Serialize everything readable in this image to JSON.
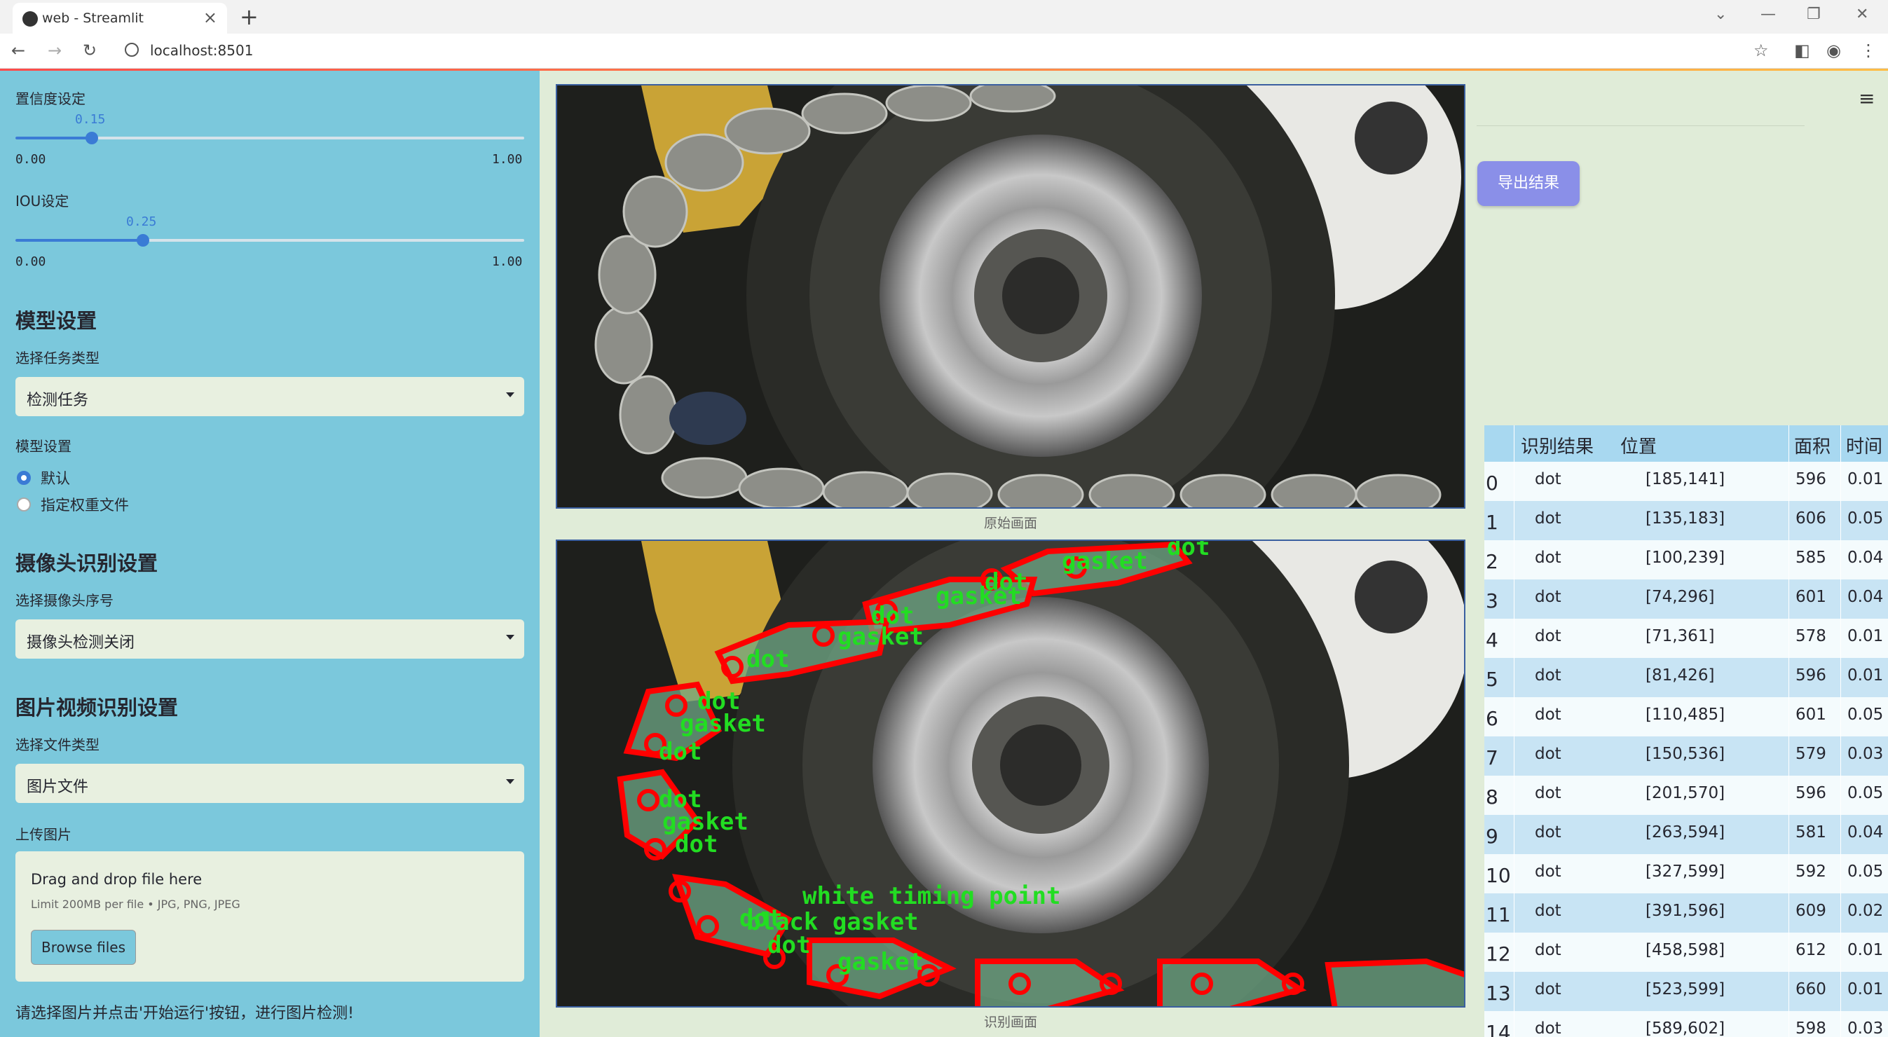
{
  "browser": {
    "tab_title": "web - Streamlit",
    "url": "localhost:8501"
  },
  "sidebar": {
    "confidence": {
      "label": "置信度设定",
      "value": "0.15",
      "min": "0.00",
      "max": "1.00",
      "fraction": 0.15
    },
    "iou": {
      "label": "IOU设定",
      "value": "0.25",
      "min": "0.00",
      "max": "1.00",
      "fraction": 0.25
    },
    "model_section": {
      "title": "模型设置",
      "task_label": "选择任务类型",
      "task_value": "检测任务",
      "model_label": "模型设置",
      "options": [
        "默认",
        "指定权重文件"
      ],
      "selected": "默认"
    },
    "camera_section": {
      "title": "摄像头识别设置",
      "camera_label": "选择摄像头序号",
      "camera_value": "摄像头检测关闭"
    },
    "file_section": {
      "title": "图片视频识别设置",
      "file_type_label": "选择文件类型",
      "file_type_value": "图片文件",
      "upload_label": "上传图片",
      "drop_text": "Drag and drop file here",
      "limit_text": "Limit 200MB per file • JPG, PNG, JPEG",
      "browse_label": "Browse files"
    },
    "note": "请选择图片并点击'开始运行'按钮，进行图片检测!"
  },
  "main": {
    "original_caption": "原始画面",
    "result_caption": "识别画面",
    "overlay_labels": [
      "dot",
      "gasket",
      "dot",
      "gasket",
      "dot",
      "gasket",
      "dot",
      "gasket",
      "dot",
      "dot",
      "gasket",
      "dot",
      "dot",
      "white timing point",
      "black gasket",
      "dot",
      "gasket"
    ]
  },
  "right": {
    "export_label": "导出结果",
    "table": {
      "headers": [
        "识别结果",
        "位置",
        "面积",
        "时间"
      ],
      "rows": [
        [
          "0",
          "dot",
          "[185,141]",
          "596",
          "0.01"
        ],
        [
          "1",
          "dot",
          "[135,183]",
          "606",
          "0.05"
        ],
        [
          "2",
          "dot",
          "[100,239]",
          "585",
          "0.04"
        ],
        [
          "3",
          "dot",
          "[74,296]",
          "601",
          "0.04"
        ],
        [
          "4",
          "dot",
          "[71,361]",
          "578",
          "0.01"
        ],
        [
          "5",
          "dot",
          "[81,426]",
          "596",
          "0.01"
        ],
        [
          "6",
          "dot",
          "[110,485]",
          "601",
          "0.05"
        ],
        [
          "7",
          "dot",
          "[150,536]",
          "579",
          "0.03"
        ],
        [
          "8",
          "dot",
          "[201,570]",
          "596",
          "0.05"
        ],
        [
          "9",
          "dot",
          "[263,594]",
          "581",
          "0.04"
        ],
        [
          "10",
          "dot",
          "[327,599]",
          "592",
          "0.05"
        ],
        [
          "11",
          "dot",
          "[391,596]",
          "609",
          "0.02"
        ],
        [
          "12",
          "dot",
          "[458,598]",
          "612",
          "0.01"
        ],
        [
          "13",
          "dot",
          "[523,599]",
          "660",
          "0.01"
        ],
        [
          "14",
          "dot",
          "[589,602]",
          "598",
          "0.03"
        ]
      ]
    }
  }
}
